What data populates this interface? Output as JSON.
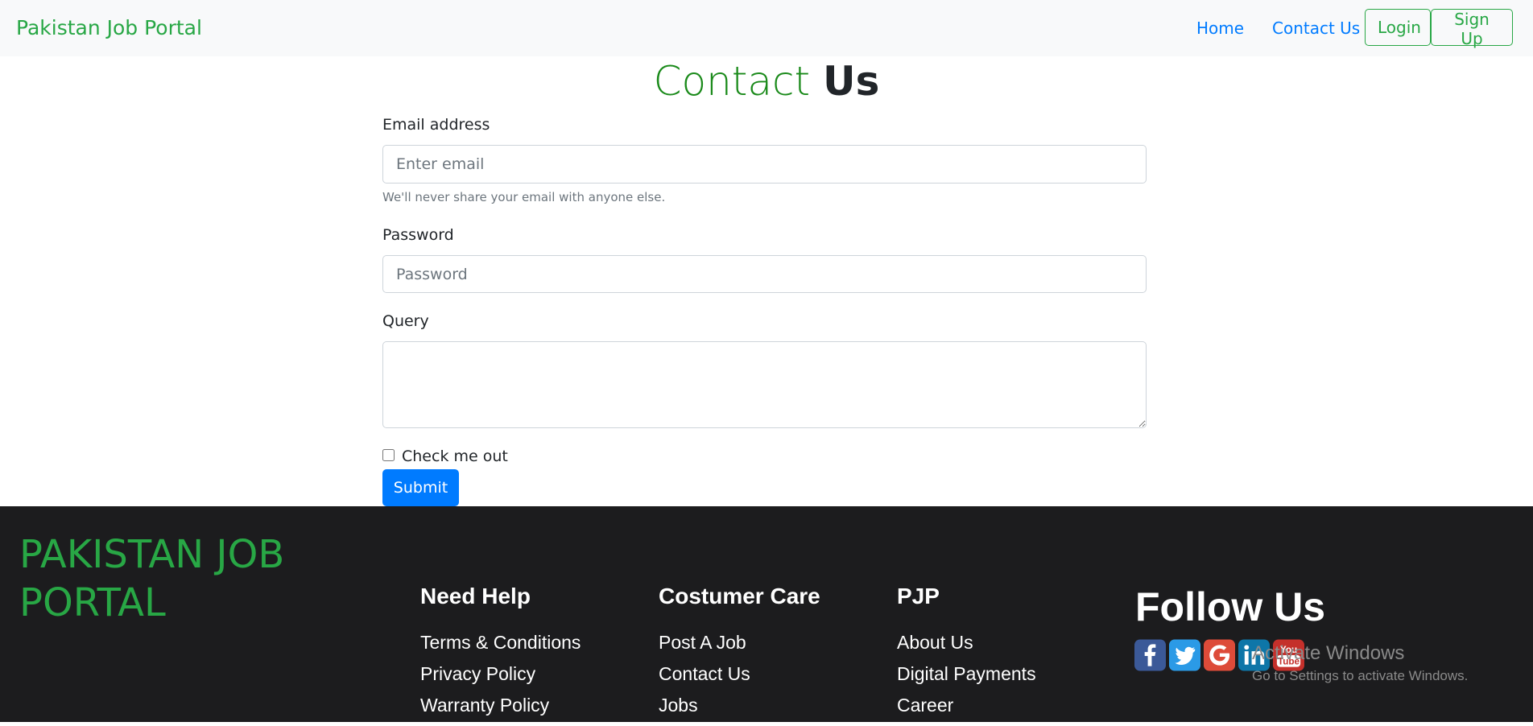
{
  "navbar": {
    "brand": "Pakistan Job Portal",
    "links": [
      "Home",
      "Contact Us"
    ],
    "login_label": "Login",
    "signup_label": "Sign Up"
  },
  "contact": {
    "title_part1": "Contact",
    "title_part2": "Us",
    "email_label": "Email address",
    "email_placeholder": "Enter email",
    "email_help": "We'll never share your email with anyone else.",
    "password_label": "Password",
    "password_placeholder": "Password",
    "query_label": "Query",
    "checkbox_label": "Check me out",
    "submit_label": "Submit"
  },
  "footer": {
    "brand": "PAKISTAN JOB PORTAL",
    "columns": [
      {
        "title": "Need Help",
        "links": [
          "Terms & Conditions",
          "Privacy Policy",
          "Warranty Policy"
        ]
      },
      {
        "title": "Costumer Care",
        "links": [
          "Post A Job",
          "Contact Us",
          "Jobs"
        ]
      },
      {
        "title": "PJP",
        "links": [
          "About Us",
          "Digital Payments",
          "Career"
        ]
      }
    ],
    "follow_title": "Follow Us",
    "social_icons": [
      "facebook-icon",
      "twitter-icon",
      "google-icon",
      "linkedin-icon",
      "youtube-icon"
    ]
  },
  "windows_watermark": {
    "line1": "Activate Windows",
    "line2": "Go to Settings to activate Windows."
  },
  "colors": {
    "brand_green": "#28a745",
    "link_blue": "#007bff",
    "footer_bg": "#1c1c1e"
  }
}
